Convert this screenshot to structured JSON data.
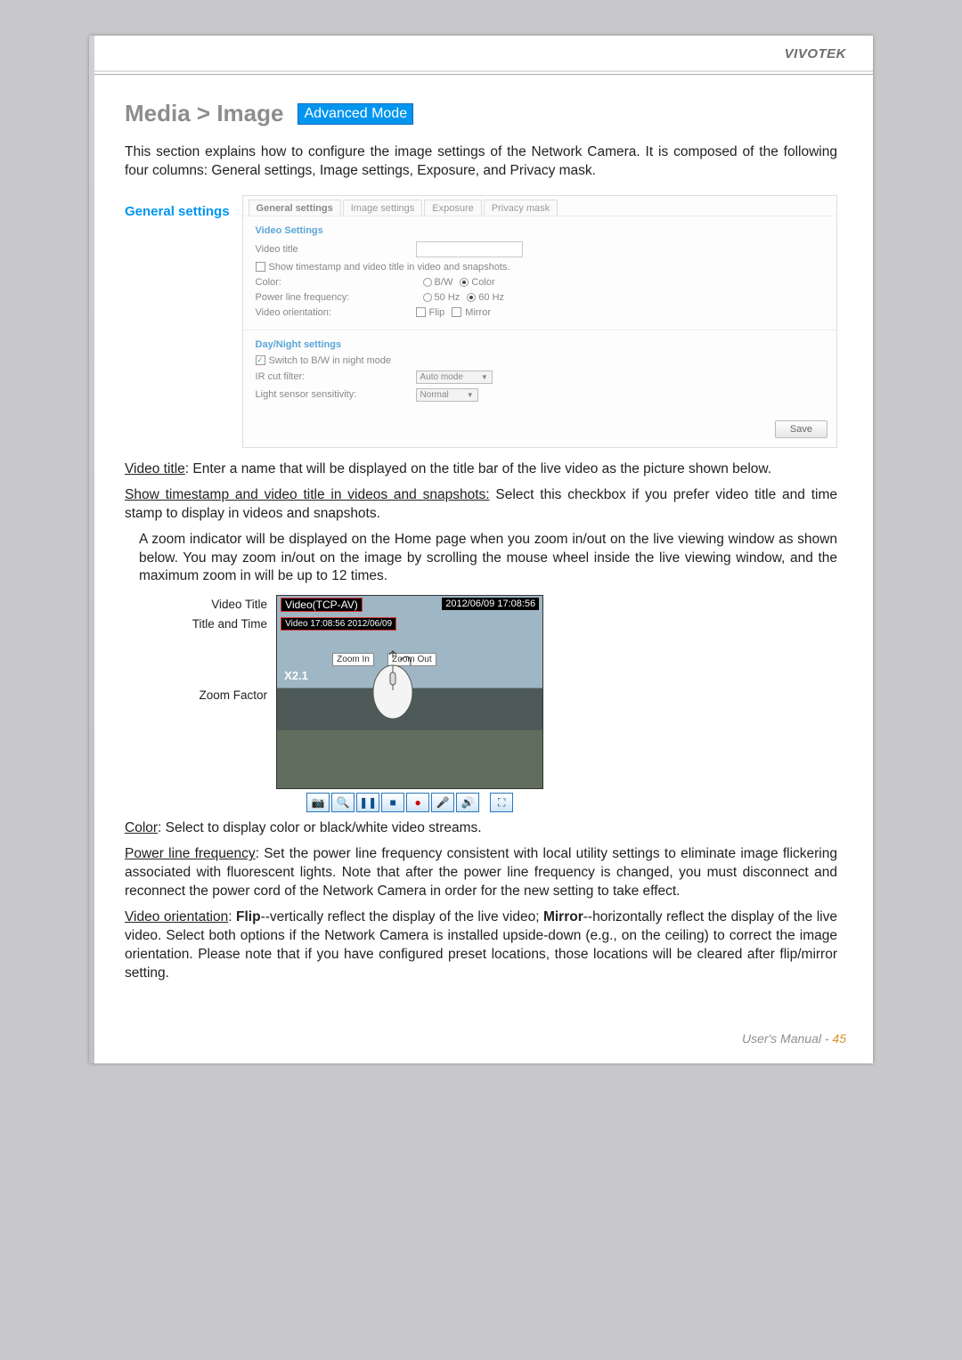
{
  "brand": "VIVOTEK",
  "title": "Media > Image",
  "badge": "Advanced Mode",
  "intro": "This section explains how to configure the image settings of the Network Camera. It is composed of the following four columns: General settings, Image settings, Exposure, and Privacy mask.",
  "gs_heading": "General settings",
  "panel": {
    "tabs": [
      "General settings",
      "Image settings",
      "Exposure",
      "Privacy mask"
    ],
    "video_settings": "Video Settings",
    "video_title_label": "Video title",
    "show_ts_label": "Show timestamp and video title in video and snapshots.",
    "color_label": "Color:",
    "color_opt1": "B/W",
    "color_opt2": "Color",
    "plf_label": "Power line frequency:",
    "plf_opt1": "50 Hz",
    "plf_opt2": "60 Hz",
    "orient_label": "Video orientation:",
    "orient_opt1": "Flip",
    "orient_opt2": "Mirror",
    "dn_heading": "Day/Night settings",
    "switch_bw": "Switch to B/W in night mode",
    "ircut_label": "IR cut filter:",
    "ircut_value": "Auto mode",
    "lss_label": "Light sensor sensitivity:",
    "lss_value": "Normal",
    "save": "Save"
  },
  "video_title_p1a": "Video title",
  "video_title_p1b": ": Enter a name that will be displayed on the title bar of the live video as the picture shown below.",
  "show_ts_p_a": "Show timestamp and video title in videos and snapshots:",
  "show_ts_p_b": " Select this checkbox if you prefer video title and time stamp to display in videos and snapshots.",
  "zoom_p": "A zoom indicator will be displayed on the Home page when you zoom in/out on the live viewing window as shown below. You may zoom in/out on the image by scrolling the mouse wheel inside the live viewing window, and the maximum zoom in will be up to 12 times.",
  "live": {
    "lbl_title": "Video Title",
    "lbl_time": "Title and Time",
    "lbl_zoom": "Zoom Factor",
    "top_text": "Video(TCP-AV)",
    "date": "2012/06/09  17:08:56",
    "stamp": "Video 17:08:56  2012/06/09",
    "zfactor": "X2.1",
    "zin": "Zoom In",
    "zout": "Zoom Out"
  },
  "color_p_a": "Color",
  "color_p_b": ": Select to display color or black/white video streams.",
  "plf_p_a": "Power line frequency",
  "plf_p_b": ": Set the power line frequency consistent with local utility settings to eliminate image flickering associated with fluorescent lights. Note that after the power line frequency is changed, you must disconnect and reconnect the power cord of the Network Camera in order for the new setting to take effect.",
  "orient_p_a": "Video orientation",
  "orient_p_b": ": ",
  "orient_p_c": "Flip",
  "orient_p_d": "--vertically reflect the display of the live video; ",
  "orient_p_e": "Mirror",
  "orient_p_f": "--horizontally reflect the display of the live video. Select both options if the Network Camera is installed upside-down (e.g., on the ceiling) to correct the image orientation. Please note that if you have configured preset locations, those locations will be cleared after flip/mirror setting.",
  "footer_label": "User's Manual - ",
  "footer_page": "45"
}
